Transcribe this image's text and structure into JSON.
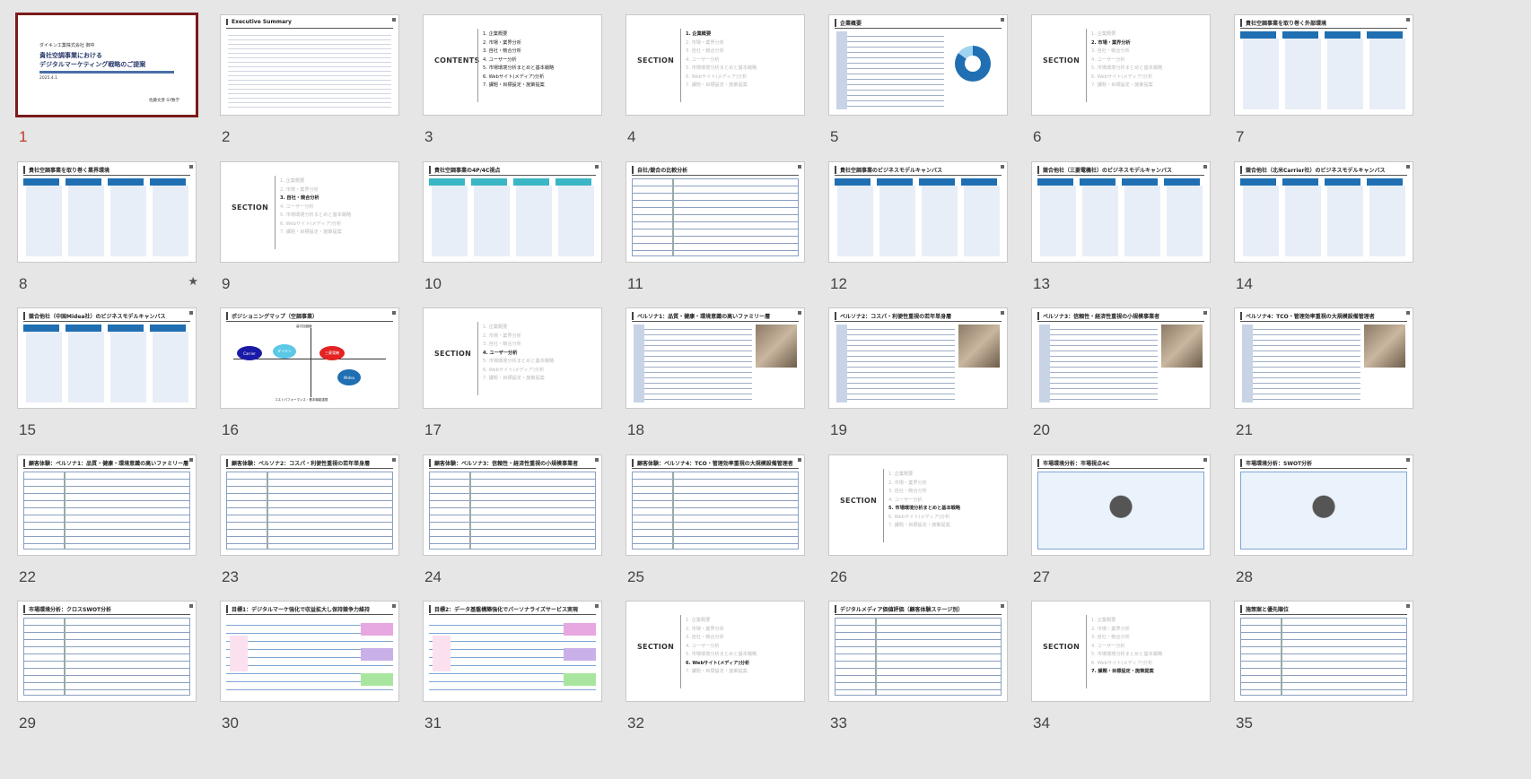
{
  "slides": [
    {
      "n": "1",
      "kind": "cover",
      "selected": true,
      "l1": "ダイキン工業株式会社 御中",
      "l2": "貴社空調事業における",
      "l3": "デジタルマーケティング戦略のご提案",
      "date": "2025.4.1",
      "foot": "佐藤文彦 SY数学"
    },
    {
      "n": "2",
      "kind": "text",
      "title": "Executive Summary"
    },
    {
      "n": "3",
      "kind": "contents",
      "label": "CONTENTS"
    },
    {
      "n": "4",
      "kind": "section",
      "label": "SECTION",
      "active": 1
    },
    {
      "n": "5",
      "kind": "profile",
      "title": "企業概要"
    },
    {
      "n": "6",
      "kind": "section",
      "label": "SECTION",
      "active": 2
    },
    {
      "n": "7",
      "kind": "boxes",
      "title": "貴社空調事業を取り巻く外部環境"
    },
    {
      "n": "8",
      "kind": "boxes",
      "title": "貴社空調事業を取り巻く業界環境",
      "star": true
    },
    {
      "n": "9",
      "kind": "section",
      "label": "SECTION",
      "active": 3
    },
    {
      "n": "10",
      "kind": "teal",
      "title": "貴社空調事業の4P/4C視点"
    },
    {
      "n": "11",
      "kind": "grid",
      "title": "自社/競合の比較分析"
    },
    {
      "n": "12",
      "kind": "boxes",
      "title": "貴社空調事業のビジネスモデルキャンバス"
    },
    {
      "n": "13",
      "kind": "boxes",
      "title": "競合他社（三菱電機社）のビジネスモデルキャンバス"
    },
    {
      "n": "14",
      "kind": "boxes",
      "title": "競合他社（北米Carrier社）のビジネスモデルキャンバス"
    },
    {
      "n": "15",
      "kind": "boxes",
      "title": "競合他社（中国Midea社）のビジネスモデルキャンバス"
    },
    {
      "n": "16",
      "kind": "map",
      "title": "ポジショニングマップ（空調事業）"
    },
    {
      "n": "17",
      "kind": "section",
      "label": "SECTION",
      "active": 4
    },
    {
      "n": "18",
      "kind": "persona",
      "title": "ペルソナ1：品質・健康・環境意識の高いファミリー層"
    },
    {
      "n": "19",
      "kind": "persona",
      "title": "ペルソナ2：コスパ・利便性重視の若年単身層"
    },
    {
      "n": "20",
      "kind": "persona",
      "title": "ペルソナ3：信頼性・経済性重視の小規模事業者"
    },
    {
      "n": "21",
      "kind": "persona",
      "title": "ペルソナ4：TCO・管理効率重視の大規模設備管理者"
    },
    {
      "n": "22",
      "kind": "journey",
      "title": "顧客体験：ペルソナ1：品質・健康・環境意識の高いファミリー層"
    },
    {
      "n": "23",
      "kind": "journey",
      "title": "顧客体験：ペルソナ2：コスパ・利便性重視の若年単身層"
    },
    {
      "n": "24",
      "kind": "journey",
      "title": "顧客体験：ペルソナ3：信頼性・経済性重視の小規模事業者"
    },
    {
      "n": "25",
      "kind": "journey",
      "title": "顧客体験：ペルソナ4：TCO・管理効率重視の大規模設備管理者"
    },
    {
      "n": "26",
      "kind": "section",
      "label": "SECTION",
      "active": 5
    },
    {
      "n": "27",
      "kind": "swot",
      "title": "市場環境分析：市場視点4C"
    },
    {
      "n": "28",
      "kind": "swot",
      "title": "市場環境分析：SWOT分析"
    },
    {
      "n": "29",
      "kind": "grid",
      "title": "市場環境分析：クロスSWOT分析"
    },
    {
      "n": "30",
      "kind": "tree",
      "title": "目標1：デジタルマーケ強化で収益拡大し保持競争力維持"
    },
    {
      "n": "31",
      "kind": "tree",
      "title": "目標2：データ基盤構築強化でパーソナライズサービス実現"
    },
    {
      "n": "32",
      "kind": "section",
      "label": "SECTION",
      "active": 6
    },
    {
      "n": "33",
      "kind": "grid",
      "title": "デジタルメディア価値評価（顧客体験ステージ別）"
    },
    {
      "n": "34",
      "kind": "section",
      "label": "SECTION",
      "active": 7
    },
    {
      "n": "35",
      "kind": "grid",
      "title": "施策案と優先順位"
    }
  ],
  "section_items": [
    "1. 企業概要",
    "2. 市場・業界分析",
    "3. 自社・競合分析",
    "4. ユーザー分析",
    "5. 市場環境分析まとめと基本戦略",
    "6. Webサイト(メディア)分析",
    "7. 課題・目標設定・施策提案"
  ],
  "position_map": {
    "top": "高付加価値",
    "bottom": "コストパフォーマンス・基本機能重視",
    "left": "家庭向け\n(住宅/小規模)",
    "right": "業務向け\n(オフィス/大規模)",
    "bubbles": [
      "Carrier",
      "ダイキン",
      "三菱電機",
      "Midea"
    ]
  },
  "colors": {
    "selected_border": "#7b1b1b",
    "selected_number": "#c0392b",
    "background": "#e6e6e6"
  }
}
